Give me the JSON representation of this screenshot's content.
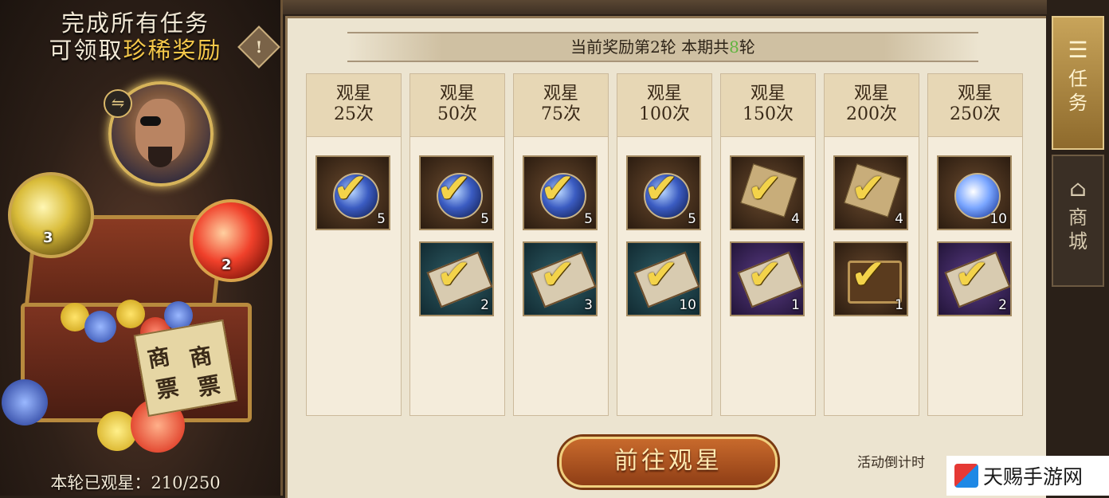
{
  "left_panel": {
    "title_line1": "完成所有任务",
    "title_line2_prefix": "可领取",
    "title_line2_highlight": "珍稀奖励",
    "info_icon": "!",
    "swap_icon": "⇋",
    "orb_gold_count": "3",
    "orb_red_count": "2",
    "scroll_chars": [
      "商",
      "票",
      "商",
      "票"
    ],
    "progress_text": "本轮已观星：210/250"
  },
  "banner": {
    "prefix": "当前奖励第2轮  本期共",
    "highlight": "8",
    "suffix": "轮"
  },
  "columns": [
    {
      "title": "观星",
      "count": "25次",
      "items": [
        {
          "type": "orb",
          "bg": "brown",
          "qty": "5"
        }
      ]
    },
    {
      "title": "观星",
      "count": "50次",
      "items": [
        {
          "type": "orb",
          "bg": "brown",
          "qty": "5"
        },
        {
          "type": "scroll",
          "bg": "teal",
          "qty": "2"
        }
      ]
    },
    {
      "title": "观星",
      "count": "75次",
      "items": [
        {
          "type": "orb",
          "bg": "brown",
          "qty": "5"
        },
        {
          "type": "scroll",
          "bg": "teal",
          "qty": "3"
        }
      ]
    },
    {
      "title": "观星",
      "count": "100次",
      "items": [
        {
          "type": "orb",
          "bg": "brown",
          "qty": "5"
        },
        {
          "type": "scroll",
          "bg": "teal",
          "qty": "10"
        }
      ]
    },
    {
      "title": "观星",
      "count": "150次",
      "items": [
        {
          "type": "card",
          "bg": "brown",
          "qty": "4"
        },
        {
          "type": "scroll",
          "bg": "purple",
          "qty": "1"
        }
      ]
    },
    {
      "title": "观星",
      "count": "200次",
      "items": [
        {
          "type": "card",
          "bg": "brown",
          "qty": "4"
        },
        {
          "type": "chest",
          "bg": "brown",
          "qty": "1"
        }
      ]
    },
    {
      "title": "观星",
      "count": "250次",
      "items": [
        {
          "type": "orb-bright",
          "bg": "brown",
          "qty": "10"
        },
        {
          "type": "scroll",
          "bg": "purple",
          "qty": "2"
        }
      ]
    }
  ],
  "go_button": "前往观星",
  "countdown": "活动倒计时",
  "tabs": {
    "task": "任务",
    "shop": "商城"
  },
  "watermark": "天赐手游网",
  "colors": {
    "highlight_gold": "#f5c84a",
    "highlight_green": "#62b441",
    "panel_bg": "#ece4d0"
  }
}
